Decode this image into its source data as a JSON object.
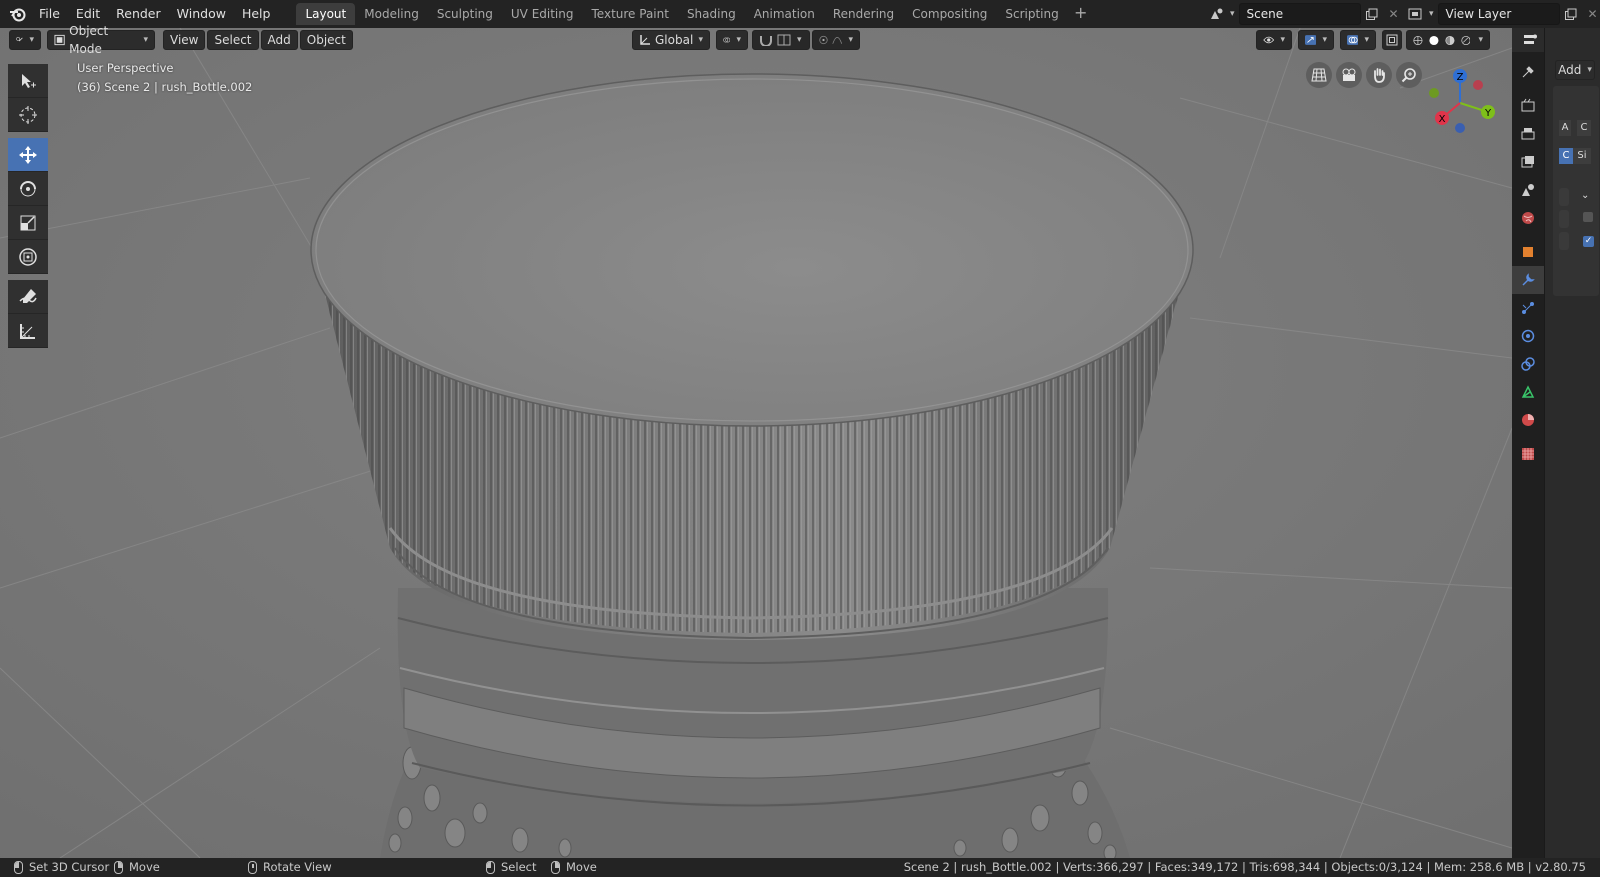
{
  "menu": [
    "File",
    "Edit",
    "Render",
    "Window",
    "Help"
  ],
  "workspaces": [
    "Layout",
    "Modeling",
    "Sculpting",
    "UV Editing",
    "Texture Paint",
    "Shading",
    "Animation",
    "Rendering",
    "Compositing",
    "Scripting"
  ],
  "active_workspace": "Layout",
  "scene": {
    "name": "Scene"
  },
  "view_layer": {
    "name": "View Layer"
  },
  "viewport_header": {
    "mode": "Object Mode",
    "menus": [
      "View",
      "Select",
      "Add",
      "Object"
    ],
    "transform_orientation": "Global"
  },
  "viewport_overlay": {
    "perspective": "User Perspective",
    "object_info": "(36) Scene 2 | rush_Bottle.002"
  },
  "gizmo": {
    "x": "X",
    "y": "Y",
    "z": "Z"
  },
  "properties": {
    "add_label": "Add",
    "tab_icons": [
      "tool-icon",
      "render-icon",
      "output-icon",
      "view-layer-icon",
      "scene-icon",
      "world-icon",
      "object-icon",
      "modifier-icon",
      "particles-icon",
      "physics-icon",
      "constraints-icon",
      "data-icon",
      "material-icon",
      "texture-icon"
    ],
    "active_tab": "modifier-icon",
    "snippets": [
      "A",
      "C",
      "C",
      "Si"
    ]
  },
  "status": {
    "set_cursor": "Set 3D Cursor",
    "move1": "Move",
    "rotate": "Rotate View",
    "select": "Select",
    "move2": "Move",
    "info": "Scene 2 | rush_Bottle.002 | Verts:366,297 | Faces:349,172 | Tris:698,344 | Objects:0/3,124 | Mem: 258.6 MB | v2.80.75"
  },
  "colors": {
    "accent": "#4772b3",
    "viewport_bg": "#7a7a7a"
  }
}
